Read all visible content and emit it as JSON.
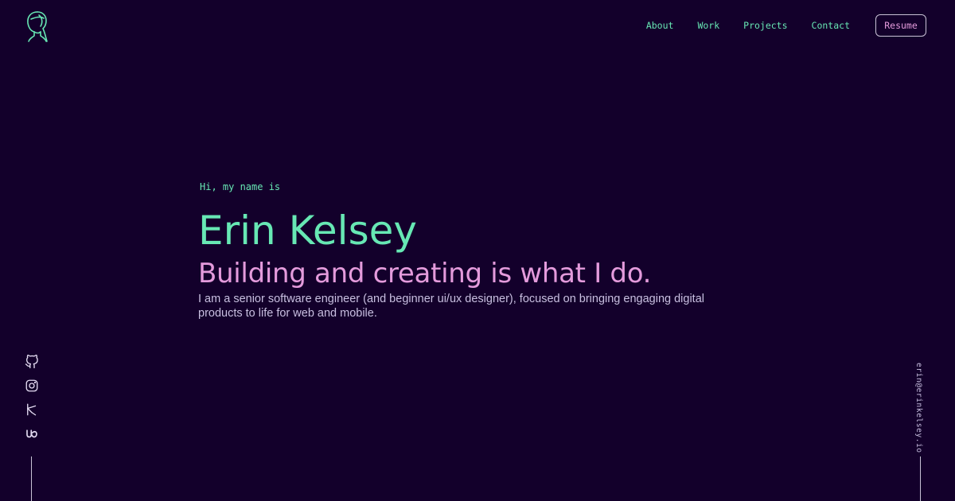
{
  "nav": {
    "links": [
      "About",
      "Work",
      "Projects",
      "Contact"
    ],
    "resume_label": "Resume"
  },
  "hero": {
    "greeting": "Hi, my name is",
    "name": "Erin Kelsey",
    "tagline": "Building and creating is what I do.",
    "intro": "I am a senior software engineer (and beginner ui/ux designer), focused on bringing engaging digital products to life for web and mobile."
  },
  "social": {
    "icons": [
      "github-icon",
      "instagram-icon",
      "dribbble-icon",
      "upwork-icon"
    ]
  },
  "email": "erin@erinkelsey.io",
  "colors": {
    "background": "#13002b",
    "accent_green": "#67e8b4",
    "accent_pink": "#e49bdc",
    "text": "#c8bfe0",
    "line": "#c9c3d6"
  }
}
